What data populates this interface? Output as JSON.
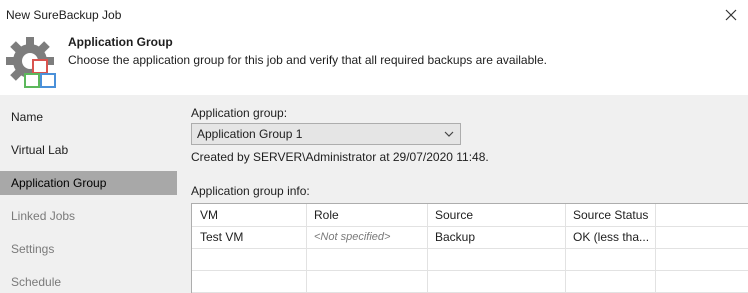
{
  "window": {
    "title": "New SureBackup Job",
    "close_icon": "close-icon"
  },
  "header": {
    "icon": "gear-with-boxes-icon",
    "title": "Application Group",
    "description": "Choose the application group for this job and verify that all required backups are available."
  },
  "sidebar": {
    "items": [
      {
        "label": "Name",
        "state": "normal"
      },
      {
        "label": "Virtual Lab",
        "state": "normal"
      },
      {
        "label": "Application Group",
        "state": "active"
      },
      {
        "label": "Linked Jobs",
        "state": "disabled"
      },
      {
        "label": "Settings",
        "state": "disabled"
      },
      {
        "label": "Schedule",
        "state": "disabled"
      }
    ]
  },
  "main": {
    "app_group_label": "Application group:",
    "app_group_value": "Application Group 1",
    "created_by": "Created by SERVER\\Administrator at 29/07/2020 11:48.",
    "info_label": "Application group info:",
    "table": {
      "columns": [
        "VM",
        "Role",
        "Source",
        "Source Status"
      ],
      "rows": [
        [
          "Test VM",
          "<Not specified>",
          "Backup",
          "OK (less tha..."
        ]
      ]
    }
  },
  "colors": {
    "sidebar_bg": "#f0f0f0",
    "active_item_bg": "#a8a8a8",
    "gear": "#7d7d7d",
    "box_red": "#d9534f",
    "box_green": "#5cb85c",
    "box_blue": "#4a90d9"
  }
}
